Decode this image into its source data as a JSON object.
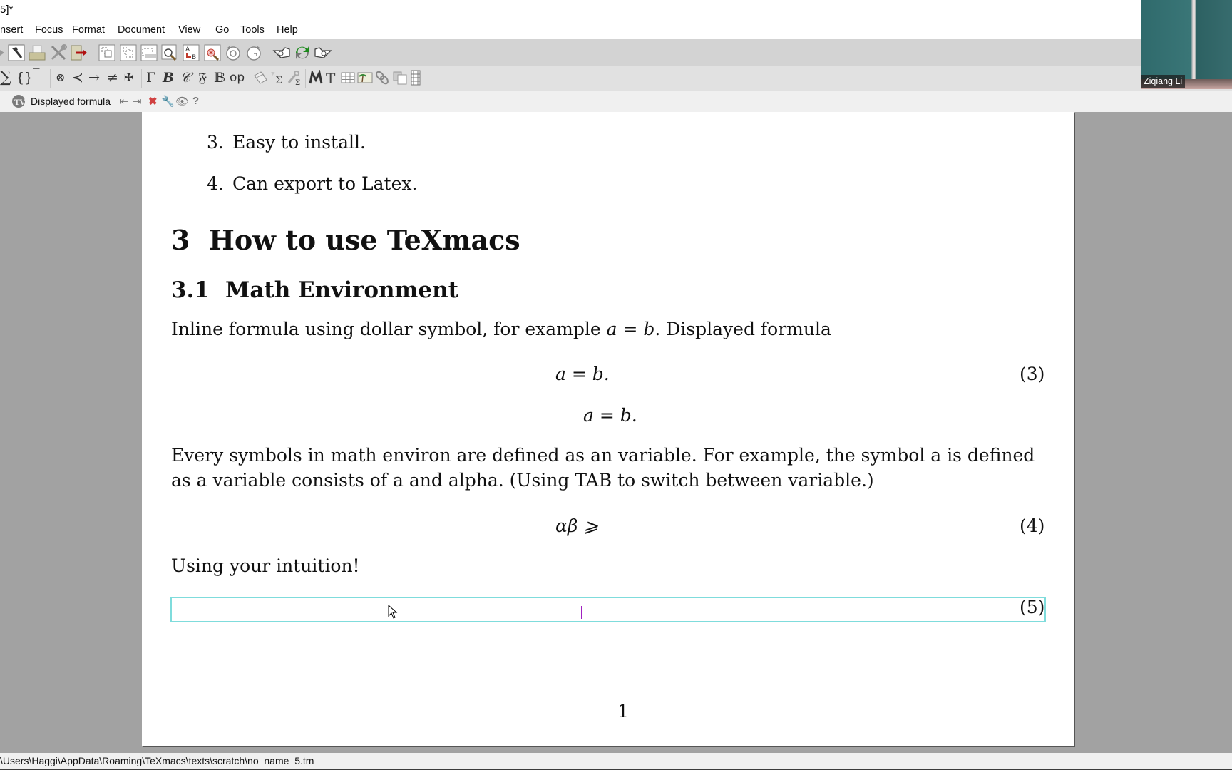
{
  "window": {
    "title": "5]*"
  },
  "menu": {
    "items": [
      "nsert",
      "Focus",
      "Format",
      "Document",
      "View",
      "Go",
      "Tools",
      "Help"
    ]
  },
  "toolbar_main": {
    "icons": [
      "bookmark-icon",
      "hammer-icon",
      "print-icon",
      "tools-icon",
      "export-icon",
      "copy-icon",
      "paste-icon",
      "cut-icon",
      "search-icon",
      "replace-icon",
      "spell-check-icon",
      "undo-icon",
      "redo-icon",
      "hand-left-icon",
      "sync-icon",
      "hand-right-icon"
    ]
  },
  "toolbar_math": {
    "symbols": [
      "∑",
      "{}",
      "‾",
      "⊗",
      "≺",
      "→",
      "≠",
      "✠",
      "Γ",
      "B",
      "𝒞",
      "𝔉",
      "𝔹",
      "op"
    ],
    "icons": [
      "tag-icon",
      "sum-style-icon",
      "math-settings-icon",
      "mode-math-icon",
      "mode-text-icon",
      "table-icon",
      "image-icon",
      "link-icon",
      "duplicate-icon",
      "film-icon"
    ]
  },
  "context_bar": {
    "label": "Displayed formula",
    "icons": [
      "move-left-icon",
      "move-right-icon",
      "delete-icon",
      "settings-icon",
      "preview-icon",
      "help-icon"
    ]
  },
  "webcam": {
    "participant_name": "Ziqiang Li"
  },
  "document": {
    "list_items": [
      {
        "number": "3.",
        "text": "Easy to install."
      },
      {
        "number": "4.",
        "text": "Can export to Latex."
      }
    ],
    "section": {
      "number": "3",
      "title": "How to use TeXmacs"
    },
    "subsection": {
      "number": "3.1",
      "title": "Math Environment"
    },
    "para1": {
      "before": "Inline formula using dollar symbol, for example ",
      "math": "a = b",
      "after": ". Displayed formula"
    },
    "equations": [
      {
        "body": "a = b.",
        "number": "(3)"
      },
      {
        "body": "a = b.",
        "number": ""
      },
      {
        "body": "αβ ⩾",
        "number": "(4)"
      },
      {
        "body": "",
        "number": "(5)"
      }
    ],
    "para2_line1": "Every symbols in math environ are defined as an variable. For example, the symbol a is defined",
    "para2_line2": "as a variable consists of a and alpha. (Using TAB to switch between variable.)",
    "para3": "Using your intuition!",
    "page_number": "1"
  },
  "status_bar": {
    "path": "\\Users\\Haggi\\AppData\\Roaming\\TeXmacs\\texts\\scratch\\no_name_5.tm"
  },
  "colors": {
    "active_equation_border": "#7fdcdc",
    "caret": "#a020c0",
    "canvas_background": "#a2a2a2"
  }
}
